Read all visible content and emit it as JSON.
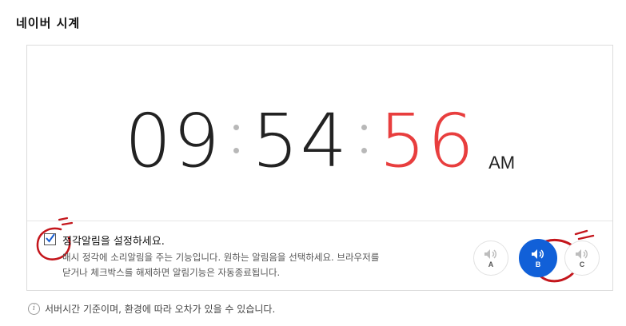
{
  "page": {
    "title": "네이버 시계"
  },
  "clock": {
    "hours": "09",
    "minutes": "54",
    "seconds": "56",
    "ampm": "AM",
    "seconds_color": "#e83e3e"
  },
  "alarm": {
    "checked": true,
    "label": "정각알림을 설정하세요.",
    "description_line1": "매시 정각에 소리알림을 주는 기능입니다. 원하는 알림음을 선택하세요. 브라우저를",
    "description_line2": "닫거나 체크박스를 해제하면 알림기능은 자동종료됩니다.",
    "sounds": [
      {
        "label": "A",
        "selected": false
      },
      {
        "label": "B",
        "selected": true
      },
      {
        "label": "C",
        "selected": false
      }
    ],
    "accent_color": "#1160d8"
  },
  "footer": {
    "icon": "info-icon",
    "note": "서버시간 기준이며, 환경에 따라 오차가 있을 수 있습니다."
  }
}
